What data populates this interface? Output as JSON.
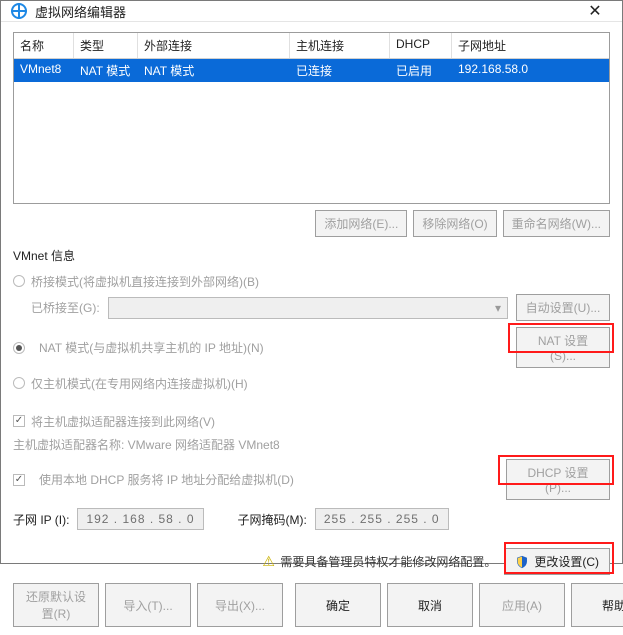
{
  "title": "虚拟网络编辑器",
  "table": {
    "cols": [
      "名称",
      "类型",
      "外部连接",
      "主机连接",
      "DHCP",
      "子网地址"
    ],
    "row": {
      "name": "VMnet8",
      "type": "NAT 模式",
      "ext": "NAT 模式",
      "host": "已连接",
      "dhcp": "已启用",
      "subnet": "192.168.58.0"
    }
  },
  "btns_mid": {
    "add": "添加网络(E)...",
    "remove": "移除网络(O)",
    "rename": "重命名网络(W)..."
  },
  "info": {
    "header": "VMnet 信息",
    "bridged": "桥接模式(将虚拟机直接连接到外部网络)(B)",
    "bridged_to": "已桥接至(G):",
    "auto": "自动设置(U)...",
    "nat": "NAT 模式(与虚拟机共享主机的 IP 地址)(N)",
    "nat_btn": "NAT 设置(S)...",
    "hostonly": "仅主机模式(在专用网络内连接虚拟机)(H)",
    "connect_host": "将主机虚拟适配器连接到此网络(V)",
    "adapter_label": "主机虚拟适配器名称: VMware 网络适配器 VMnet8",
    "dhcp_chk": "使用本地 DHCP 服务将 IP 地址分配给虚拟机(D)",
    "dhcp_btn": "DHCP 设置(P)...",
    "subnet_ip_label": "子网 IP (I):",
    "subnet_ip": "192 . 168 .  58  .  0",
    "mask_label": "子网掩码(M):",
    "mask": "255 . 255 . 255 .  0"
  },
  "admin": {
    "msg": "需要具备管理员特权才能修改网络配置。",
    "change": "更改设置(C)"
  },
  "footer": {
    "restore": "还原默认设置(R)",
    "import": "导入(T)...",
    "export": "导出(X)...",
    "ok": "确定",
    "cancel": "取消",
    "apply": "应用(A)",
    "help": "帮助"
  }
}
